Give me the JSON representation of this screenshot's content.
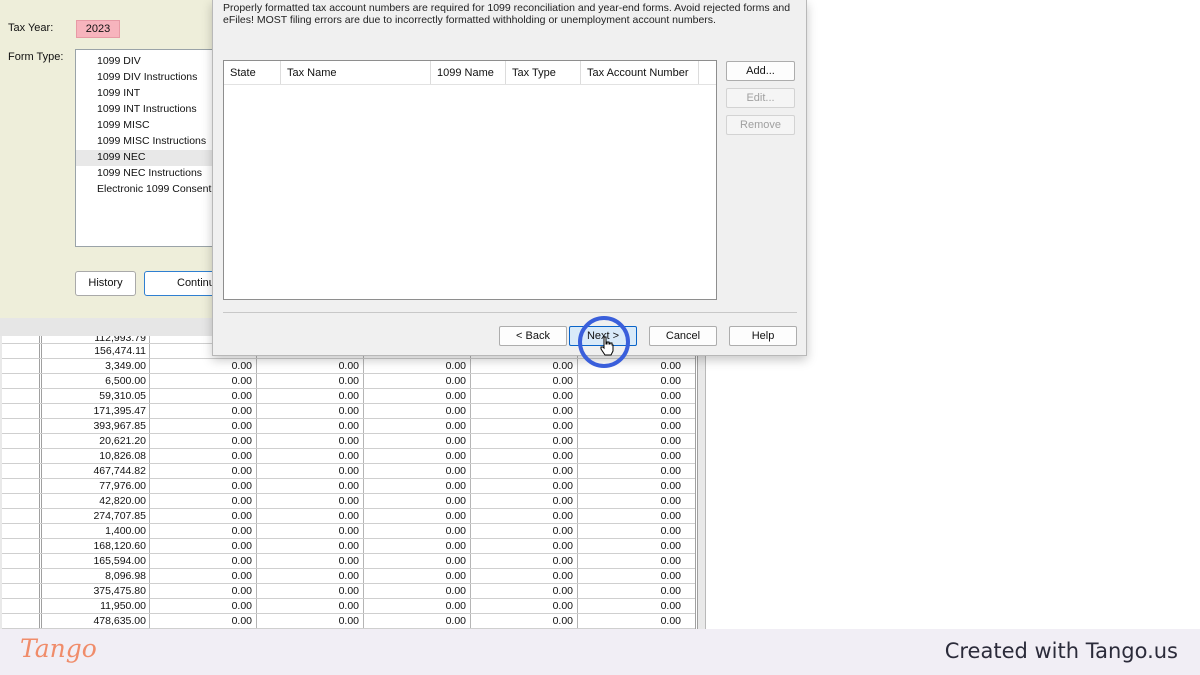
{
  "app": {
    "tax_year_label": "Tax Year:",
    "tax_year_value": "2023",
    "form_type_label": "Form Type:",
    "form_types": [
      "1099 DIV",
      "1099 DIV Instructions",
      "1099 INT",
      "1099 INT Instructions",
      "1099 MISC",
      "1099 MISC Instructions",
      "1099 NEC",
      "1099 NEC Instructions",
      "Electronic 1099 Consent"
    ],
    "selected_form_type": "1099 NEC",
    "history_label": "History",
    "continue_label": "Continu"
  },
  "grid": {
    "partial_top_value": "112,993.79",
    "rows": [
      {
        "amount": "156,474.11",
        "values": []
      },
      {
        "amount": "3,349.00",
        "values": [
          "0.00",
          "0.00",
          "0.00",
          "0.00",
          "0.00"
        ]
      },
      {
        "amount": "6,500.00",
        "values": [
          "0.00",
          "0.00",
          "0.00",
          "0.00",
          "0.00"
        ]
      },
      {
        "amount": "59,310.05",
        "values": [
          "0.00",
          "0.00",
          "0.00",
          "0.00",
          "0.00"
        ]
      },
      {
        "amount": "171,395.47",
        "values": [
          "0.00",
          "0.00",
          "0.00",
          "0.00",
          "0.00"
        ]
      },
      {
        "amount": "393,967.85",
        "values": [
          "0.00",
          "0.00",
          "0.00",
          "0.00",
          "0.00"
        ]
      },
      {
        "amount": "20,621.20",
        "values": [
          "0.00",
          "0.00",
          "0.00",
          "0.00",
          "0.00"
        ]
      },
      {
        "amount": "10,826.08",
        "values": [
          "0.00",
          "0.00",
          "0.00",
          "0.00",
          "0.00"
        ]
      },
      {
        "amount": "467,744.82",
        "values": [
          "0.00",
          "0.00",
          "0.00",
          "0.00",
          "0.00"
        ]
      },
      {
        "amount": "77,976.00",
        "values": [
          "0.00",
          "0.00",
          "0.00",
          "0.00",
          "0.00"
        ]
      },
      {
        "amount": "42,820.00",
        "values": [
          "0.00",
          "0.00",
          "0.00",
          "0.00",
          "0.00"
        ]
      },
      {
        "amount": "274,707.85",
        "values": [
          "0.00",
          "0.00",
          "0.00",
          "0.00",
          "0.00"
        ]
      },
      {
        "amount": "1,400.00",
        "values": [
          "0.00",
          "0.00",
          "0.00",
          "0.00",
          "0.00"
        ]
      },
      {
        "amount": "168,120.60",
        "values": [
          "0.00",
          "0.00",
          "0.00",
          "0.00",
          "0.00"
        ]
      },
      {
        "amount": "165,594.00",
        "values": [
          "0.00",
          "0.00",
          "0.00",
          "0.00",
          "0.00"
        ]
      },
      {
        "amount": "8,096.98",
        "values": [
          "0.00",
          "0.00",
          "0.00",
          "0.00",
          "0.00"
        ]
      },
      {
        "amount": "375,475.80",
        "values": [
          "0.00",
          "0.00",
          "0.00",
          "0.00",
          "0.00"
        ]
      },
      {
        "amount": "11,950.00",
        "values": [
          "0.00",
          "0.00",
          "0.00",
          "0.00",
          "0.00"
        ]
      },
      {
        "amount": "478,635.00",
        "values": [
          "0.00",
          "0.00",
          "0.00",
          "0.00",
          "0.00"
        ]
      }
    ]
  },
  "dialog": {
    "description": "Properly formatted tax account numbers are required for 1099 reconciliation and year-end forms. Avoid rejected forms and eFiles! MOST filing errors are due to incorrectly formatted withholding or unemployment account numbers.",
    "columns": [
      "State",
      "Tax Name",
      "1099 Name",
      "Tax Type",
      "Tax Account Number"
    ],
    "add_label": "Add...",
    "edit_label": "Edit...",
    "remove_label": "Remove",
    "back_label": "< Back",
    "next_label": "Next >",
    "cancel_label": "Cancel",
    "help_label": "Help"
  },
  "footer": {
    "logo_text": "Tango",
    "credit": "Created with Tango.us"
  },
  "colors": {
    "tax_year_bg": "#f7b4bd",
    "highlight_ring": "#3a5fdb",
    "primary_button_border": "#0a64c8",
    "tango_orange": "#f08c6a"
  }
}
